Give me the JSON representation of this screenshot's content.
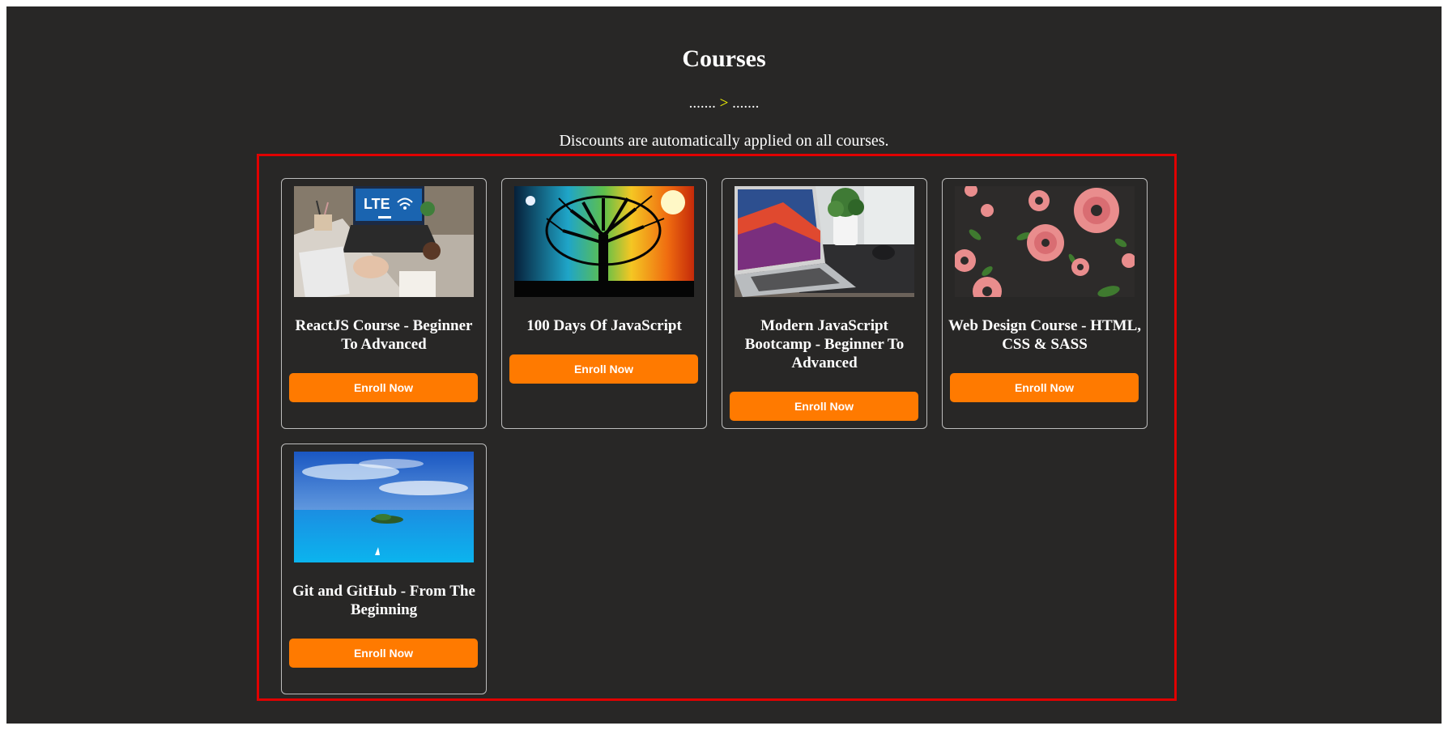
{
  "header": {
    "title": "Courses",
    "divider_left": ".......",
    "divider_arrow": ">",
    "divider_right": ".......",
    "subtitle": "Discounts are automatically applied on all courses."
  },
  "courses": [
    {
      "title": "ReactJS Course - Beginner To Advanced",
      "button": "Enroll Now",
      "image": "laptop-desk-image"
    },
    {
      "title": "100 Days Of JavaScript",
      "button": "Enroll Now",
      "image": "tree-night-day-image"
    },
    {
      "title": "Modern JavaScript Bootcamp - Beginner To Advanced",
      "button": "Enroll Now",
      "image": "laptop-plant-image"
    },
    {
      "title": "Web Design Course - HTML, CSS & SASS",
      "button": "Enroll Now",
      "image": "flower-pattern-image"
    },
    {
      "title": "Git and GitHub - From The Beginning",
      "button": "Enroll Now",
      "image": "ocean-island-image"
    }
  ],
  "colors": {
    "background": "#282726",
    "accent": "#ff7a00",
    "highlight_border": "#e00000",
    "divider_arrow": "#ffff00"
  }
}
